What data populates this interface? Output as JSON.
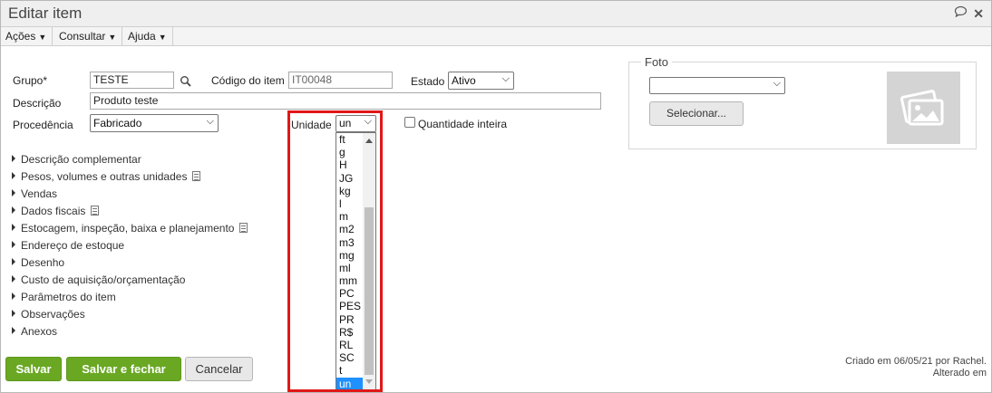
{
  "window": {
    "title": "Editar item"
  },
  "menubar": {
    "items": [
      {
        "label": "Ações"
      },
      {
        "label": "Consultar"
      },
      {
        "label": "Ajuda"
      }
    ]
  },
  "form": {
    "grupo_label": "Grupo*",
    "grupo_value": "TESTE",
    "codigo_label": "Código do item",
    "codigo_value": "IT00048",
    "estado_label": "Estado",
    "estado_value": "Ativo",
    "descricao_label": "Descrição",
    "descricao_value": "Produto teste",
    "procedencia_label": "Procedência",
    "procedencia_value": "Fabricado",
    "unidade_label": "Unidade",
    "unidade_value": "un",
    "quantidade_label": "Quantidade inteira",
    "quantidade_checked": false
  },
  "unit_options": [
    "ft",
    "g",
    "H",
    "JG",
    "kg",
    "l",
    "m",
    "m2",
    "m3",
    "mg",
    "ml",
    "mm",
    "PC",
    "PES",
    "PR",
    "R$",
    "RL",
    "SC",
    "t",
    "un"
  ],
  "sections": [
    {
      "label": "Descrição complementar",
      "has_icon": false
    },
    {
      "label": "Pesos, volumes e outras unidades",
      "has_icon": true
    },
    {
      "label": "Vendas",
      "has_icon": false
    },
    {
      "label": "Dados fiscais",
      "has_icon": true
    },
    {
      "label": "Estocagem, inspeção, baixa e planejamento",
      "has_icon": true
    },
    {
      "label": "Endereço de estoque",
      "has_icon": false
    },
    {
      "label": "Desenho",
      "has_icon": false
    },
    {
      "label": "Custo de aquisição/orçamentação",
      "has_icon": false
    },
    {
      "label": "Parâmetros do item",
      "has_icon": false
    },
    {
      "label": "Observações",
      "has_icon": false
    },
    {
      "label": "Anexos",
      "has_icon": false
    }
  ],
  "foto": {
    "legend": "Foto",
    "select_value": "",
    "select_button": "Selecionar..."
  },
  "footer": {
    "save": "Salvar",
    "save_close": "Salvar e fechar",
    "cancel": "Cancelar",
    "created": "Criado em 06/05/21 por Rachel.",
    "altered": "Alterado em"
  },
  "colors": {
    "primary_green": "#6aa823",
    "highlight_red": "#e01818",
    "selected_option": "#1e90ff"
  }
}
